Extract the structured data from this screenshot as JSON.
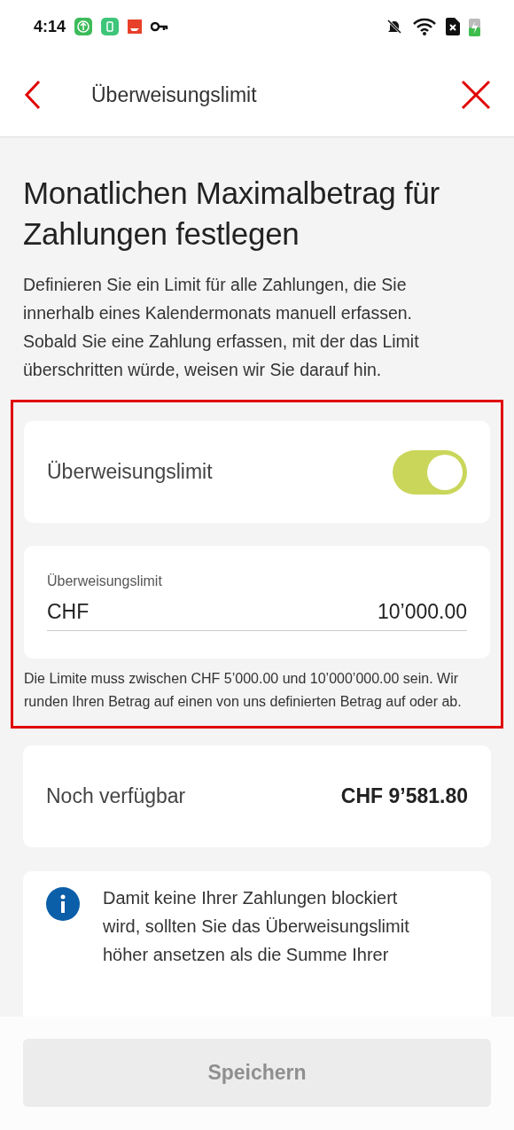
{
  "status_bar": {
    "time": "4:14"
  },
  "header": {
    "title": "Überweisungslimit"
  },
  "heading": "Monatlichen Maximalbetrag für Zahlungen festlegen",
  "description": "Definieren Sie ein Limit für alle Zahlungen, die Sie innerhalb eines Kalendermonats manuell erfassen. Sobald Sie eine Zahlung erfassen, mit der das Limit überschritten würde, weisen wir Sie darauf hin.",
  "limit_toggle": {
    "label": "Überweisungslimit",
    "on": true
  },
  "amount_field": {
    "label": "Überweisungslimit",
    "currency": "CHF",
    "value": "10’000.00"
  },
  "hint": "Die Limite muss zwischen CHF 5’000.00 und 10’000’000.00 sein. Wir runden Ihren Betrag auf einen von uns definierten Betrag auf oder ab.",
  "available": {
    "label": "Noch verfügbar",
    "value": "CHF 9’581.80"
  },
  "info": "Damit keine Ihrer Zahlungen blockiert wird, sollten Sie das Überweisungslimit höher ansetzen als die Summe Ihrer",
  "save_button": {
    "label": "Speichern",
    "disabled": true
  }
}
